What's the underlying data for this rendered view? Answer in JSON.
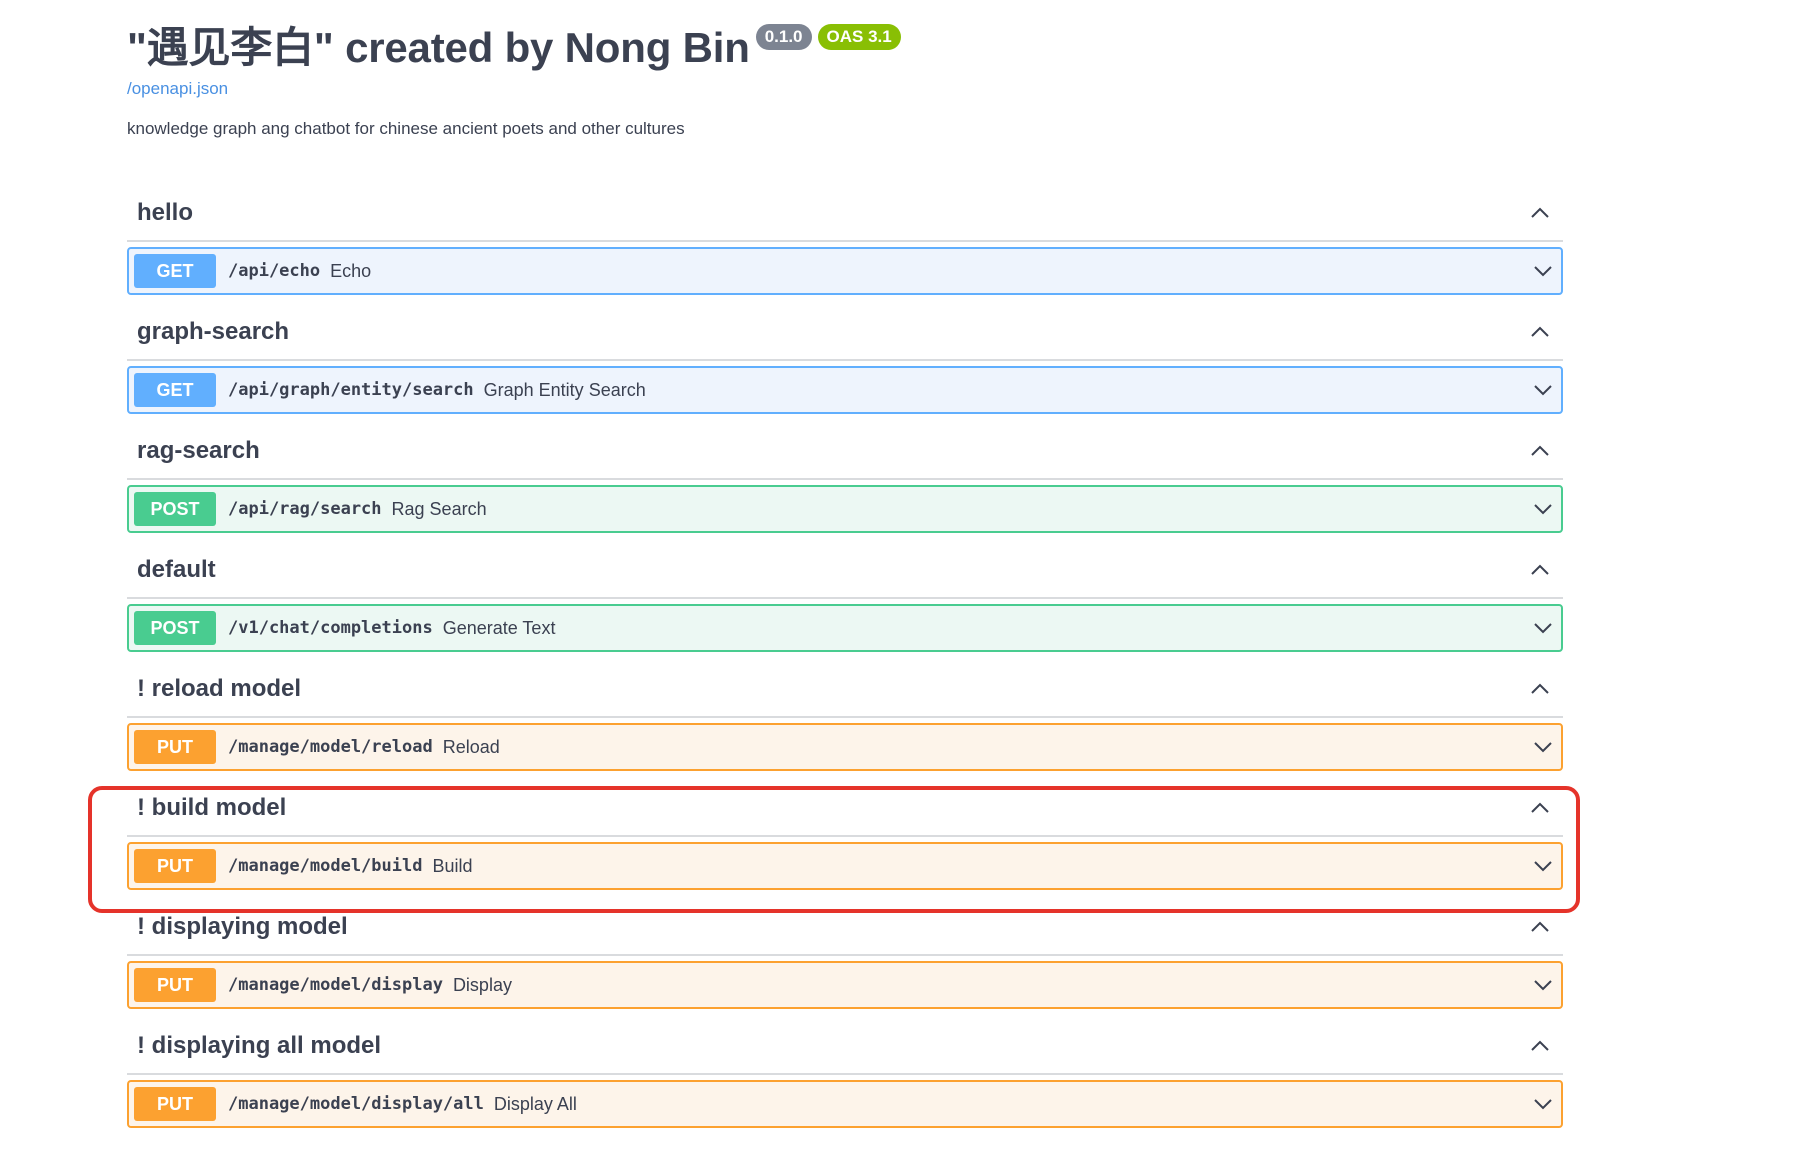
{
  "info": {
    "title": "\"遇见李白\" created by Nong Bin",
    "version_badge": "0.1.0",
    "oas_badge": "OAS 3.1",
    "spec_link": "/openapi.json",
    "description": "knowledge graph ang chatbot for chinese ancient poets and other cultures"
  },
  "colors": {
    "get": "#61affe",
    "post": "#49cc90",
    "put": "#fca130",
    "highlight": "#e5332a"
  },
  "tags": [
    {
      "name": "hello",
      "ops": [
        {
          "method": "GET",
          "path": "/api/echo",
          "summary": "Echo"
        }
      ]
    },
    {
      "name": "graph-search",
      "ops": [
        {
          "method": "GET",
          "path": "/api/graph/entity/search",
          "summary": "Graph Entity Search"
        }
      ]
    },
    {
      "name": "rag-search",
      "ops": [
        {
          "method": "POST",
          "path": "/api/rag/search",
          "summary": "Rag Search"
        }
      ]
    },
    {
      "name": "default",
      "ops": [
        {
          "method": "POST",
          "path": "/v1/chat/completions",
          "summary": "Generate Text"
        }
      ]
    },
    {
      "name": "! reload model",
      "ops": [
        {
          "method": "PUT",
          "path": "/manage/model/reload",
          "summary": "Reload"
        }
      ]
    },
    {
      "name": "! build model",
      "ops": [
        {
          "method": "PUT",
          "path": "/manage/model/build",
          "summary": "Build"
        }
      ]
    },
    {
      "name": "! displaying model",
      "ops": [
        {
          "method": "PUT",
          "path": "/manage/model/display",
          "summary": "Display"
        }
      ]
    },
    {
      "name": "! displaying all model",
      "ops": [
        {
          "method": "PUT",
          "path": "/manage/model/display/all",
          "summary": "Display All"
        }
      ]
    }
  ],
  "icons": {
    "collapse": "chevron-up-icon",
    "expand": "chevron-down-icon"
  },
  "highlighted_tag": "! build model"
}
